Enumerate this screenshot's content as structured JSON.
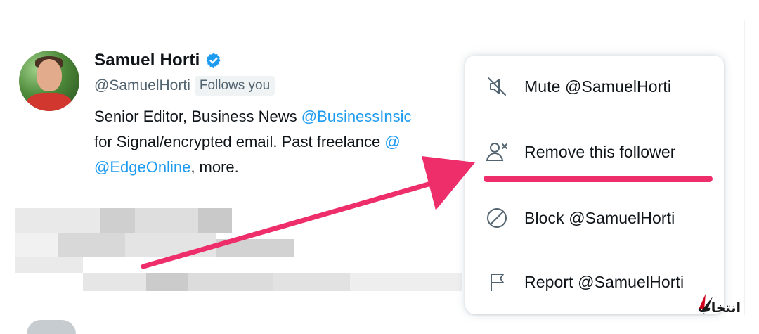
{
  "profile": {
    "display_name": "Samuel Horti",
    "handle": "@SamuelHorti",
    "follows_badge": "Follows you",
    "bio_line1_text": "Senior Editor, Business News ",
    "bio_line1_mention": "@BusinessInsic",
    "bio_line2_text": "for Signal/encrypted email. Past freelance ",
    "bio_line2_mention": "@",
    "bio_line3_mention": "@EdgeOnline",
    "bio_line3_text": ", more."
  },
  "menu": {
    "items": [
      {
        "label": "Mute @SamuelHorti",
        "icon": "mute-icon"
      },
      {
        "label": "Remove this follower",
        "icon": "remove-follower-icon"
      },
      {
        "label": "Block @SamuelHorti",
        "icon": "block-icon"
      },
      {
        "label": "Report @SamuelHorti",
        "icon": "report-flag-icon"
      }
    ]
  },
  "watermark_text": "انتخاب",
  "colors": {
    "accent_blue": "#1d9bf0",
    "annotation_pink": "#ee2d6b",
    "text_primary": "#0f1419",
    "text_secondary": "#536471",
    "watermark_red": "#d0021b"
  }
}
